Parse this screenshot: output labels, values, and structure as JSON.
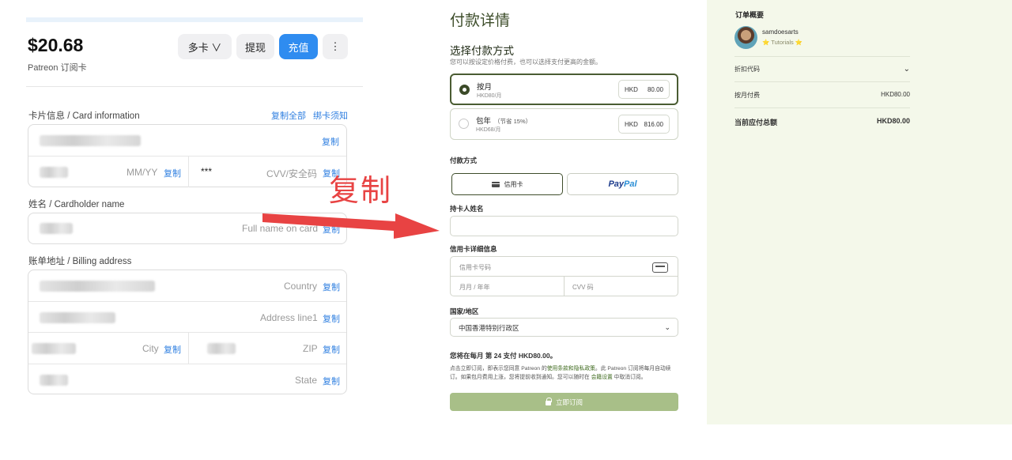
{
  "left": {
    "balance": "$20.68",
    "balance_sub": "Patreon 订阅卡",
    "buttons": {
      "multi_card": "多卡 ∨",
      "withdraw": "提现",
      "topup": "充值",
      "more": "⋮"
    },
    "card_info": {
      "label": "卡片信息 / Card information",
      "copy_all": "复制全部",
      "bind_notice": "绑卡须知"
    },
    "expiry_placeholder": "MM/YY",
    "cvv_value": "***",
    "cvv_placeholder": "CVV/安全码",
    "cardholder": {
      "label": "姓名 / Cardholder name",
      "placeholder": "Full name on card"
    },
    "billing": {
      "label": "账单地址 / Billing address",
      "country": "Country",
      "address1": "Address line1",
      "city": "City",
      "zip": "ZIP",
      "state": "State"
    },
    "copy": "复制"
  },
  "annotation": {
    "label": "复制",
    "arrow_color": "#e84343"
  },
  "middle": {
    "title": "付款详情",
    "choose_method": "选择付款方式",
    "note": "您可以按设定价格付费，也可以选择支付更高的金额。",
    "plans": [
      {
        "name": "按月",
        "save": "",
        "sub": "HKD80/月",
        "currency": "HKD",
        "amount": "80.00",
        "selected": true
      },
      {
        "name": "包年",
        "save": "（节省 15%）",
        "sub": "HKD68/月",
        "currency": "HKD",
        "amount": "816.00",
        "selected": false
      }
    ],
    "pay_method_label": "付款方式",
    "credit_card": "信用卡",
    "paypal_a": "Pay",
    "paypal_b": "Pal",
    "cardholder_label": "持卡人姓名",
    "card_details_label": "信用卡详细信息",
    "card_number_placeholder": "信用卡号码",
    "expiry_placeholder": "月月 / 年年",
    "cvv_placeholder": "CVV 码",
    "country_label": "国家/地区",
    "country_value": "中国香港特别行政区",
    "bill_note": "您将在每月 第 24 支付 HKD80.00。",
    "terms_a": "点击立即订阅，即表示您同意 Patreon 的",
    "terms_link1": "使用条款和隐私政策",
    "terms_b": "。此 Patreon 订阅将每月自动续订。如果包月费用上涨，您将提前收到通知。您可以随时在 ",
    "terms_link2": "会籍设置",
    "terms_c": " 中取消订阅。",
    "subscribe": "立即订阅"
  },
  "right": {
    "title": "订单概要",
    "creator": "samdoesarts",
    "tier": "⭐ Tutorials ⭐",
    "discount": "折扣代码",
    "monthly_label": "按月付费",
    "monthly_amount": "HKD80.00",
    "total_label": "当前应付总额",
    "total_amount": "HKD80.00"
  }
}
